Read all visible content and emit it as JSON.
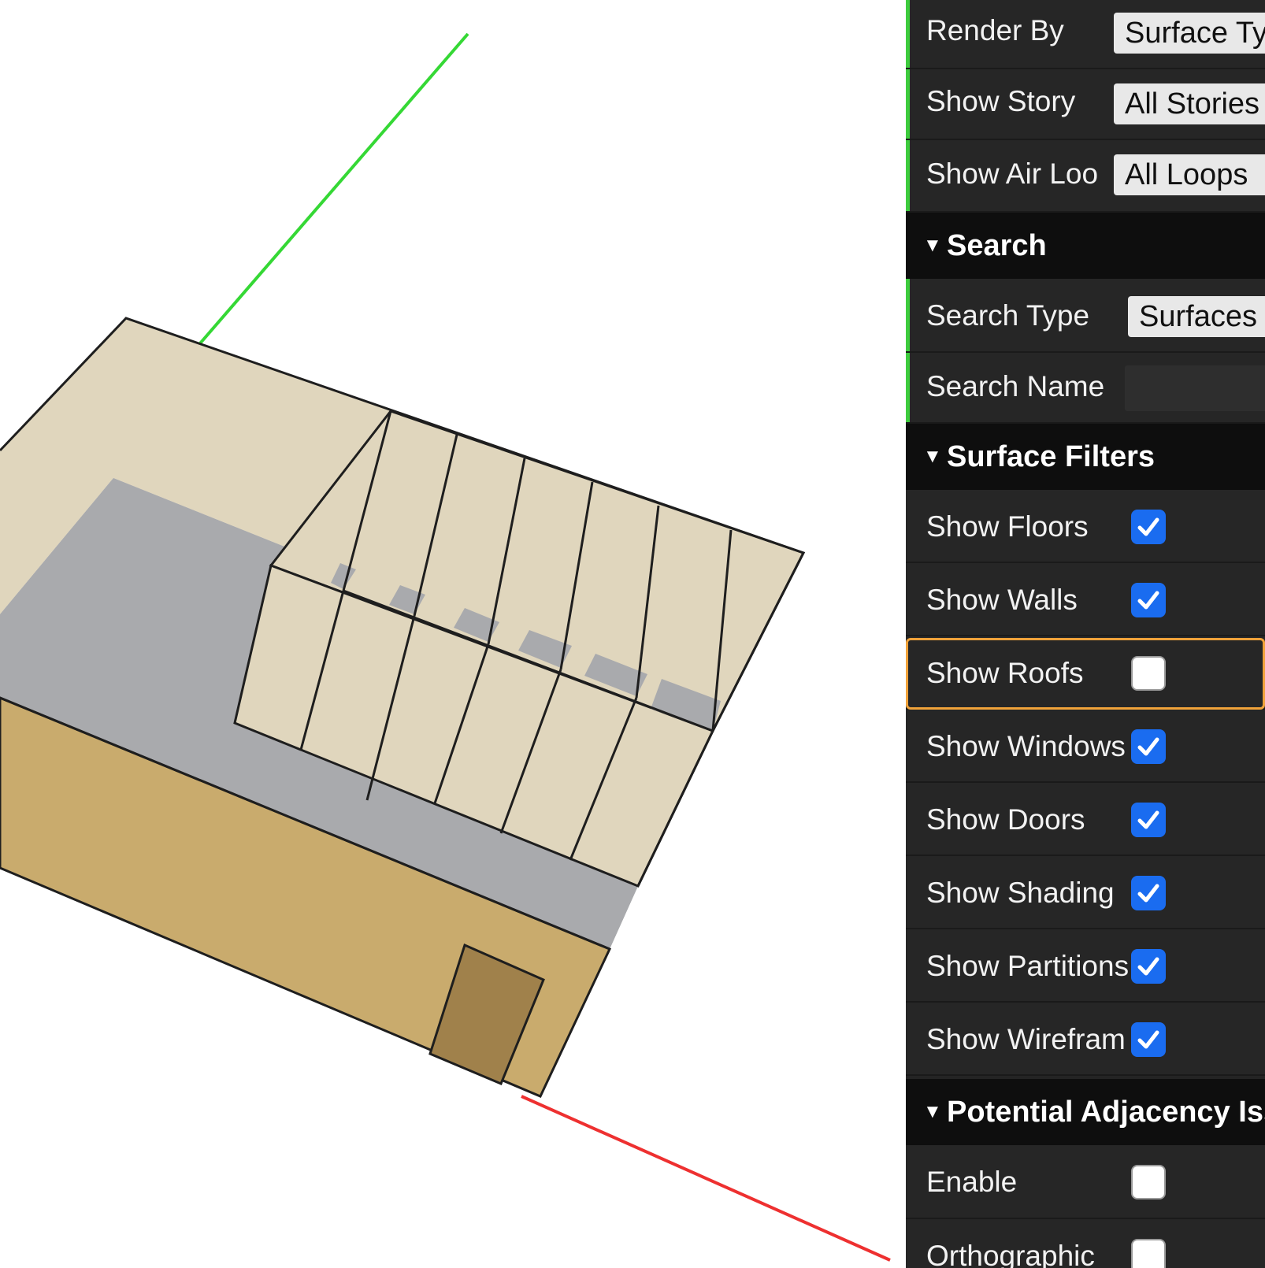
{
  "viewport": {
    "axes": {
      "y_color": "#35d835",
      "x_color": "#ee3030"
    },
    "colors": {
      "roof": "#e0d6bd",
      "wall": "#c9ab6d",
      "floor": "#a9aaad",
      "door": "#a0814b",
      "outline": "#1e1e1e"
    }
  },
  "panel": {
    "render_by": {
      "label": "Render By",
      "value": "Surface Ty"
    },
    "show_story": {
      "label": "Show Story",
      "value": "All Stories"
    },
    "show_air_loops": {
      "label": "Show Air Loo",
      "value": "All Loops"
    },
    "search_section": {
      "title": "Search"
    },
    "search_type": {
      "label": "Search Type",
      "value": "Surfaces"
    },
    "search_name": {
      "label": "Search Name",
      "value": ""
    },
    "surface_filters_section": {
      "title": "Surface Filters"
    },
    "filters": [
      {
        "label": "Show Floors",
        "checked": true
      },
      {
        "label": "Show Walls",
        "checked": true
      },
      {
        "label": "Show Roofs",
        "checked": false,
        "focused": true
      },
      {
        "label": "Show Windows",
        "checked": true
      },
      {
        "label": "Show Doors",
        "checked": true
      },
      {
        "label": "Show Shading",
        "checked": true
      },
      {
        "label": "Show Partitions",
        "checked": true
      },
      {
        "label": "Show Wirefram",
        "checked": true
      }
    ],
    "adjacency_section": {
      "title": "Potential Adjacency Iss"
    },
    "adjacency": [
      {
        "label": "Enable",
        "checked": false
      },
      {
        "label": "Orthographic",
        "checked": false
      }
    ]
  }
}
